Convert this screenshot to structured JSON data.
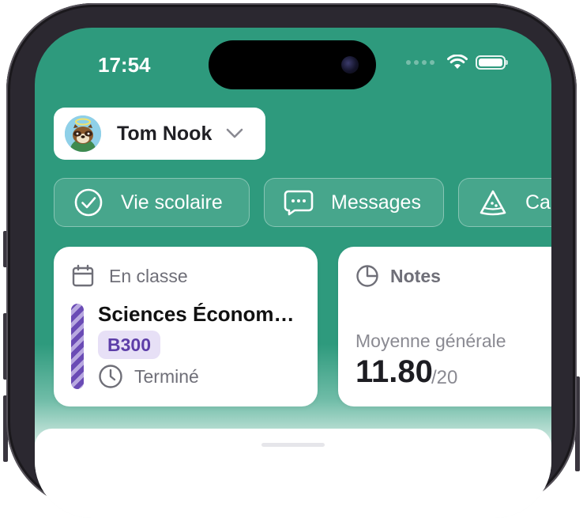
{
  "status_bar": {
    "time": "17:54"
  },
  "user": {
    "name": "Tom Nook"
  },
  "chips": [
    {
      "label": "Vie scolaire",
      "icon": "check-circle-icon"
    },
    {
      "label": "Messages",
      "icon": "chat-bubble-icon"
    },
    {
      "label": "Ca",
      "icon": "pizza-slice-icon"
    }
  ],
  "class_card": {
    "title": "En classe",
    "subject": "Sciences Économ…",
    "room": "B300",
    "status": "Terminé"
  },
  "grades_card": {
    "title": "Notes",
    "average_label": "Moyenne générale",
    "average": "11.80",
    "denominator": "/20"
  },
  "colors": {
    "header_green": "#2e9a7d",
    "room_badge_bg": "#e7e0f6",
    "room_badge_text": "#5d3ea8",
    "subject_stripe": "#6a4bb5"
  }
}
